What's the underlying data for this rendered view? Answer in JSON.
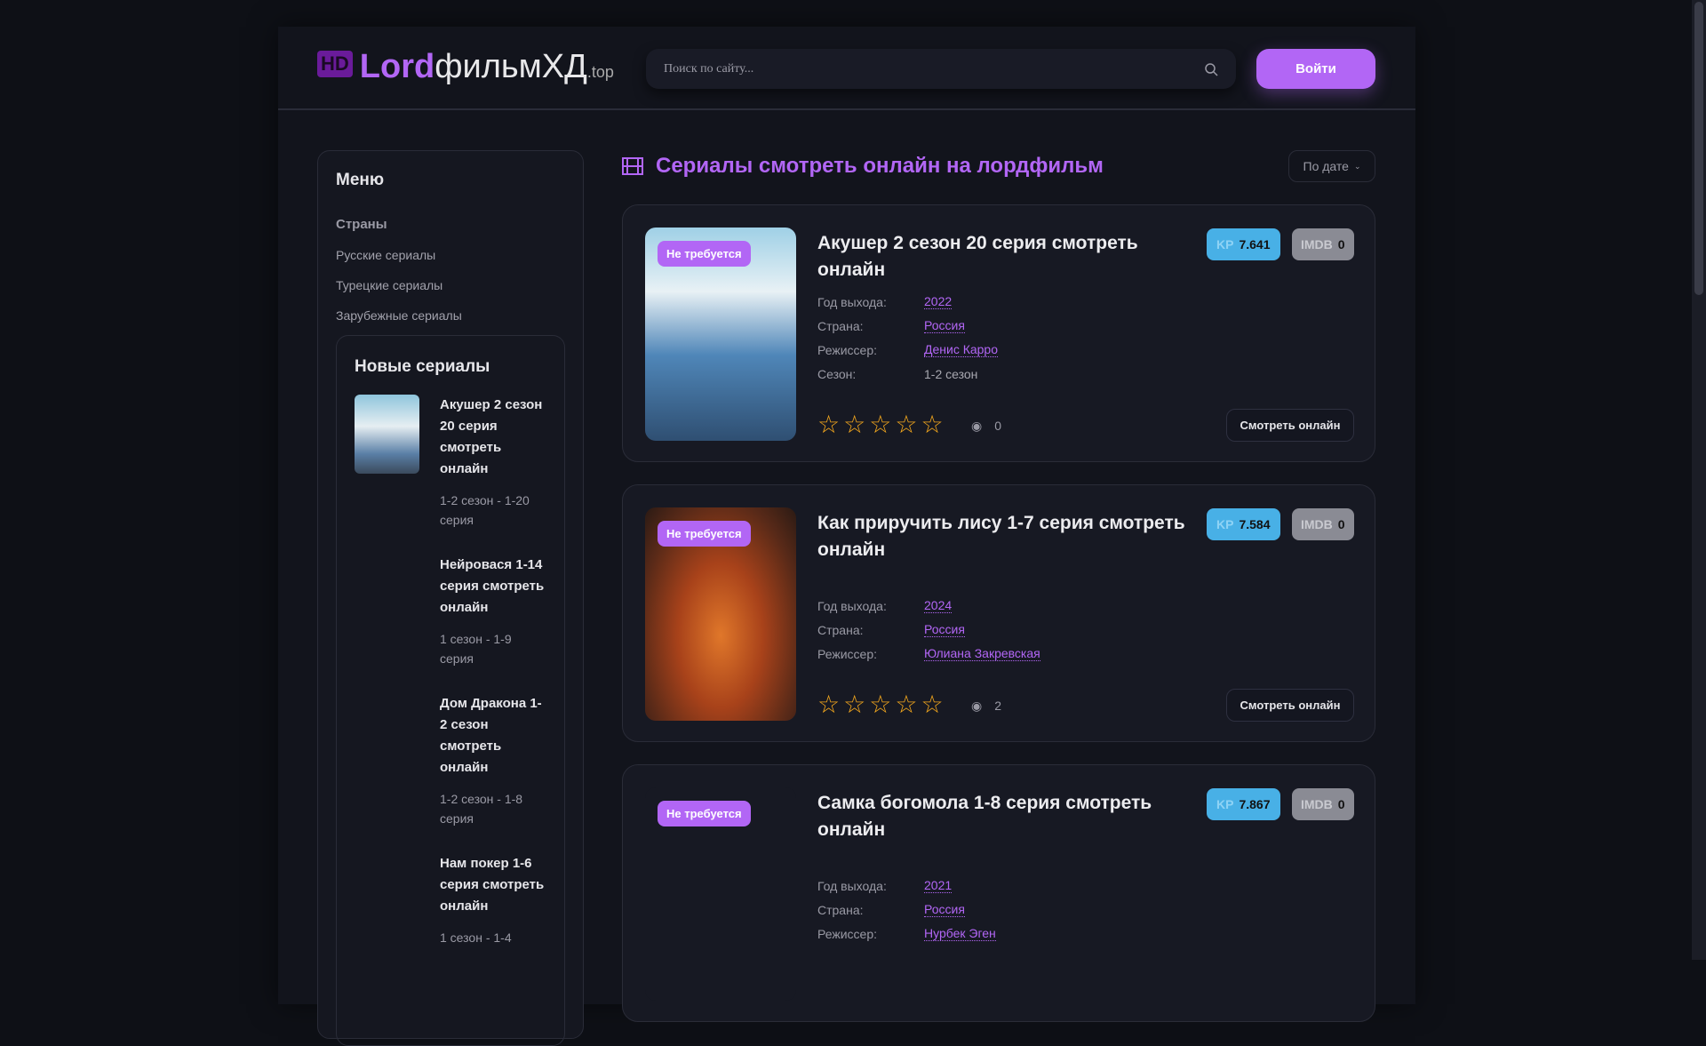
{
  "header": {
    "logo_hd": "HD",
    "logo_lord": "Lord",
    "logo_film": "фильмХД",
    "logo_tld": ".top",
    "search_placeholder": "Поиск по сайту...",
    "login": "Войти"
  },
  "sidebar": {
    "menu_title": "Меню",
    "countries": "Страны",
    "links": [
      "Русские сериалы",
      "Турецкие сериалы",
      "Зарубежные сериалы"
    ],
    "new_title": "Новые сериалы",
    "new_items": [
      {
        "title": "Акушер 2 сезон 20 серия смотреть онлайн",
        "meta": "1-2 сезон - 1-20 серия"
      },
      {
        "title": "Нейровася 1-14 серия смотреть онлайн",
        "meta": "1 сезон - 1-9 серия"
      },
      {
        "title": "Дом Дракона 1-2 сезон смотреть онлайн",
        "meta": "1-2 сезон - 1-8 серия"
      },
      {
        "title": "Нам покер 1-6 серия смотреть онлайн",
        "meta": "1 сезон - 1-4"
      }
    ]
  },
  "main": {
    "title": "Сериалы смотреть онлайн на лордфильм",
    "sort": "По дате",
    "accent": "#b266f5",
    "labels": {
      "year": "Год выхода:",
      "country": "Страна:",
      "director": "Режиссер:",
      "season": "Сезон:",
      "kp": "KP",
      "imdb": "IMDB",
      "badge": "Не требуется",
      "watch": "Смотреть онлайн"
    },
    "cards": [
      {
        "title": "Акушер 2 сезон 20 серия смотреть онлайн",
        "kp": "7.641",
        "imdb": "0",
        "year": "2022",
        "country": "Россия",
        "director": "Денис Карро",
        "season": "1-2 сезон",
        "views": "0",
        "rating_stars": 0
      },
      {
        "title": "Как приручить лису 1-7 серия смотреть онлайн",
        "kp": "7.584",
        "imdb": "0",
        "year": "2024",
        "country": "Россия",
        "director": "Юлиана Закревская",
        "views": "2",
        "rating_stars": 0
      },
      {
        "title": "Самка богомола 1-8 серия смотреть онлайн",
        "kp": "7.867",
        "imdb": "0",
        "year": "2021",
        "country": "Россия",
        "director": "Нурбек Эген"
      }
    ]
  }
}
